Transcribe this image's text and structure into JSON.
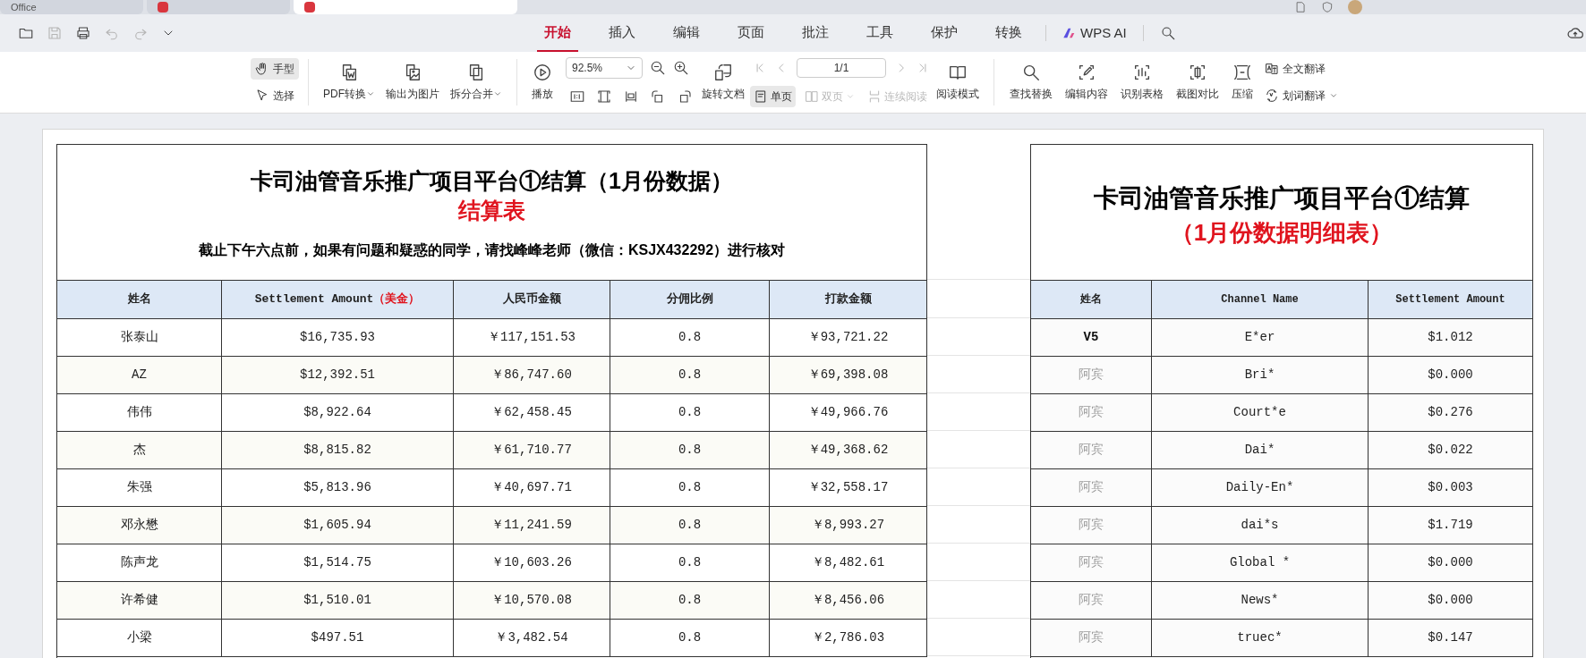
{
  "browser_tabs": [
    {
      "label": "Office",
      "selected": false
    },
    {
      "selected": false
    },
    {
      "selected": true
    }
  ],
  "quick_access": {
    "save_disabled": true,
    "undo_disabled": true,
    "redo_disabled": true
  },
  "menu_tabs": [
    {
      "label": "开始",
      "selected": true
    },
    {
      "label": "插入",
      "selected": false
    },
    {
      "label": "编辑",
      "selected": false
    },
    {
      "label": "页面",
      "selected": false
    },
    {
      "label": "批注",
      "selected": false
    },
    {
      "label": "工具",
      "selected": false
    },
    {
      "label": "保护",
      "selected": false
    },
    {
      "label": "转换",
      "selected": false
    }
  ],
  "ai_tab": "WPS AI",
  "ribbon": {
    "pointer_tools": [
      {
        "label": "手型",
        "selected": true
      },
      {
        "label": "选择",
        "selected": false
      }
    ],
    "convert_buttons": [
      {
        "label": "PDF转换",
        "dropdown": true
      },
      {
        "label": "输出为图片",
        "dropdown": false
      },
      {
        "label": "拆分合并",
        "dropdown": true
      }
    ],
    "play_button": "播放",
    "zoom": {
      "value": "92.5%"
    },
    "rotate_button": "旋转文档",
    "page_field": "1/1",
    "page_modes": [
      {
        "label": "单页",
        "selected": true,
        "disabled": false,
        "dropdown": false
      },
      {
        "label": "双页",
        "selected": false,
        "disabled": true,
        "dropdown": true
      },
      {
        "label": "连续阅读",
        "selected": false,
        "disabled": true,
        "dropdown": false
      }
    ],
    "reading_mode_button": "阅读模式",
    "tool_buttons": [
      "查找替换",
      "编辑内容",
      "识别表格",
      "截图对比",
      "压缩"
    ],
    "translate": [
      {
        "label": "全文翻译",
        "dropdown": false
      },
      {
        "label": "划词翻译",
        "dropdown": true
      }
    ]
  },
  "settlement_table": {
    "title": "卡司油管音乐推广项目平台①结算（1月份数据）",
    "subtitle": "结算表",
    "notice": "截止下午六点前，如果有问题和疑惑的同学，请找峰峰老师（微信：KSJX432292）进行核对",
    "columns": [
      {
        "label": "姓名"
      },
      {
        "label": "Settlement Amount",
        "note": "（美金）"
      },
      {
        "label": "人民币金额"
      },
      {
        "label": "分佣比例"
      },
      {
        "label": "打款金额"
      }
    ],
    "rows": [
      [
        "张泰山",
        "$16,735.93",
        "￥117,151.53",
        "0.8",
        "￥93,721.22"
      ],
      [
        "AZ",
        "$12,392.51",
        "￥86,747.60",
        "0.8",
        "￥69,398.08"
      ],
      [
        "伟伟",
        "$8,922.64",
        "￥62,458.45",
        "0.8",
        "￥49,966.76"
      ],
      [
        "杰",
        "$8,815.82",
        "￥61,710.77",
        "0.8",
        "￥49,368.62"
      ],
      [
        "朱强",
        "$5,813.96",
        "￥40,697.71",
        "0.8",
        "￥32,558.17"
      ],
      [
        "邓永懋",
        "$1,605.94",
        "￥11,241.59",
        "0.8",
        "￥8,993.27"
      ],
      [
        "陈声龙",
        "$1,514.75",
        "￥10,603.26",
        "0.8",
        "￥8,482.61"
      ],
      [
        "许希健",
        "$1,510.01",
        "￥10,570.08",
        "0.8",
        "￥8,456.06"
      ],
      [
        "小梁",
        "$497.51",
        "￥3,482.54",
        "0.8",
        "￥2,786.03"
      ]
    ]
  },
  "detail_table": {
    "title": "卡司油管音乐推广项目平台①结算",
    "subtitle": "（1月份数据明细表）",
    "columns": [
      "姓名",
      "Channel Name",
      "Settlement Amount"
    ],
    "rows": [
      {
        "cells": [
          "V5",
          "E*er",
          "$1.012"
        ],
        "greyed": false
      },
      {
        "cells": [
          "阿宾",
          "Bri*",
          "$0.000"
        ],
        "greyed": true
      },
      {
        "cells": [
          "阿宾",
          "Court*e",
          "$0.276"
        ],
        "greyed": true
      },
      {
        "cells": [
          "阿宾",
          "Dai*",
          "$0.022"
        ],
        "greyed": true
      },
      {
        "cells": [
          "阿宾",
          "Daily-En*",
          "$0.003"
        ],
        "greyed": true
      },
      {
        "cells": [
          "阿宾",
          "dai*s",
          "$1.719"
        ],
        "greyed": true
      },
      {
        "cells": [
          "阿宾",
          "Global *",
          "$0.000"
        ],
        "greyed": true
      },
      {
        "cells": [
          "阿宾",
          "News*",
          "$0.000"
        ],
        "greyed": true
      },
      {
        "cells": [
          "阿宾",
          "truec*",
          "$0.147"
        ],
        "greyed": true
      }
    ]
  }
}
